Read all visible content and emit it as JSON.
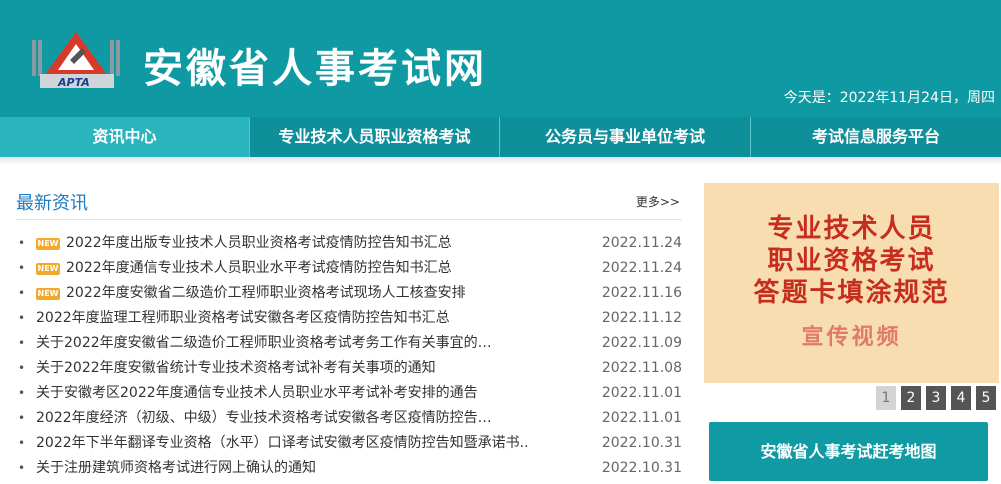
{
  "header": {
    "logo_text": "APTA",
    "title": "安徽省人事考试网",
    "date": "今天是：2022年11月24日，周四"
  },
  "nav": [
    {
      "label": "资讯中心",
      "active": true
    },
    {
      "label": "专业技术人员职业资格考试",
      "active": false
    },
    {
      "label": "公务员与事业单位考试",
      "active": false
    },
    {
      "label": "考试信息服务平台",
      "active": false
    }
  ],
  "news": {
    "title": "最新资讯",
    "more": "更多>>",
    "badge": "NEW",
    "items": [
      {
        "text": "2022年度出版专业技术人员职业资格考试疫情防控告知书汇总",
        "date": "2022.11.24",
        "new": true
      },
      {
        "text": "2022年度通信专业技术人员职业水平考试疫情防控告知书汇总",
        "date": "2022.11.24",
        "new": true
      },
      {
        "text": "2022年度安徽省二级造价工程师职业资格考试现场人工核查安排",
        "date": "2022.11.16",
        "new": true
      },
      {
        "text": "2022年度监理工程师职业资格考试安徽各考区疫情防控告知书汇总",
        "date": "2022.11.12",
        "new": false
      },
      {
        "text": "关于2022年度安徽省二级造价工程师职业资格考试考务工作有关事宜的…",
        "date": "2022.11.09",
        "new": false
      },
      {
        "text": "关于2022年度安徽省统计专业技术资格考试补考有关事项的通知",
        "date": "2022.11.08",
        "new": false
      },
      {
        "text": "关于安徽考区2022年度通信专业技术人员职业水平考试补考安排的通告",
        "date": "2022.11.01",
        "new": false
      },
      {
        "text": "2022年度经济（初级、中级）专业技术资格考试安徽各考区疫情防控告…",
        "date": "2022.11.01",
        "new": false
      },
      {
        "text": "2022年下半年翻译专业资格（水平）口译考试安徽考区疫情防控告知暨承诺书..",
        "date": "2022.10.31",
        "new": false
      },
      {
        "text": "关于注册建筑师资格考试进行网上确认的通知",
        "date": "2022.10.31",
        "new": false
      }
    ]
  },
  "banner": {
    "line1": "专业技术人员",
    "line2": "职业资格考试",
    "line3": "答题卡填涂规范",
    "subtitle": "宣传视频"
  },
  "pager": [
    "1",
    "2",
    "3",
    "4",
    "5"
  ],
  "map_button": "安徽省人事考试赶考地图",
  "colors": {
    "teal": "#0f9aa3",
    "accent": "#1b7bc0",
    "banner_red": "#c62d1f",
    "banner_bg": "#f8ddb0"
  }
}
